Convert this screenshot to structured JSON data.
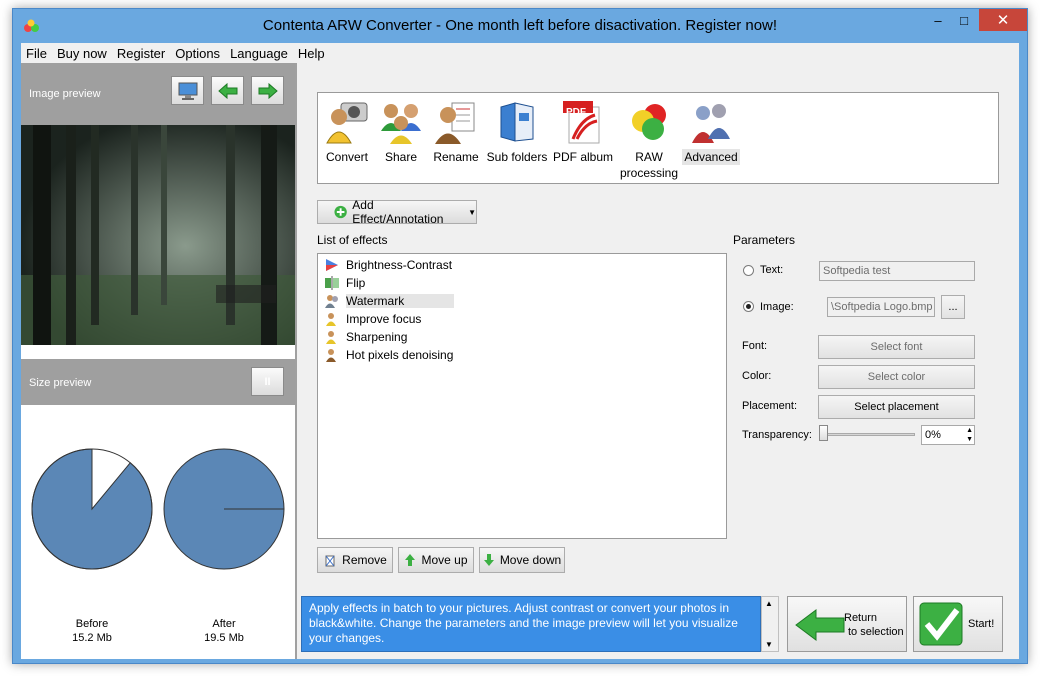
{
  "window": {
    "title": "Contenta ARW Converter  - One month left before disactivation. Register now!",
    "minimize": "–",
    "maximize": "□",
    "close": "✕"
  },
  "menu": [
    "File",
    "Buy now",
    "Register",
    "Options",
    "Language",
    "Help"
  ],
  "left": {
    "image_preview_label": "Image preview",
    "size_preview_label": "Size preview",
    "pause": "II",
    "before": {
      "label": "Before",
      "size": "15.2 Mb",
      "fraction": 0.89
    },
    "after": {
      "label": "After",
      "size": "19.5 Mb",
      "fraction": 1.0
    },
    "pie_color": "#5b87b6"
  },
  "toolbar": [
    {
      "label": "Convert",
      "icon": "convert-icon"
    },
    {
      "label": "Share",
      "icon": "share-icon"
    },
    {
      "label": "Rename",
      "icon": "rename-icon"
    },
    {
      "label": "Sub folders",
      "icon": "subfolders-icon"
    },
    {
      "label": "PDF album",
      "icon": "pdf-album-icon",
      "badge": "PDF"
    },
    {
      "label": "RAW processing",
      "icon": "raw-processing-icon"
    },
    {
      "label": "Advanced",
      "icon": "advanced-icon",
      "selected": true
    }
  ],
  "add_effect": "Add Effect/Annotation",
  "list_label": "List of effects",
  "effects": [
    "Brightness-Contrast",
    "Flip",
    "Watermark",
    "Improve focus",
    "Sharpening",
    "Hot pixels denoising"
  ],
  "selected_effect": 2,
  "list_buttons": {
    "remove": "Remove",
    "move_up": "Move up",
    "move_down": "Move down"
  },
  "params": {
    "title": "Parameters",
    "text_label": "Text:",
    "text_value": "Softpedia test",
    "image_label": "Image:",
    "image_value": "\\Softpedia Logo.bmp",
    "browse": "...",
    "font_label": "Font:",
    "font_btn": "Select font",
    "color_label": "Color:",
    "color_btn": "Select color",
    "placement_label": "Placement:",
    "placement_btn": "Select placement",
    "transparency_label": "Transparency:",
    "transparency_value": "0%"
  },
  "info": "Apply effects in batch to your pictures. Adjust contrast or convert your photos in black&white. Change the parameters and the image preview will let you visualize your changes.",
  "return_btn": {
    "line1": "Return",
    "line2": "to selection"
  },
  "start_btn": "Start!"
}
